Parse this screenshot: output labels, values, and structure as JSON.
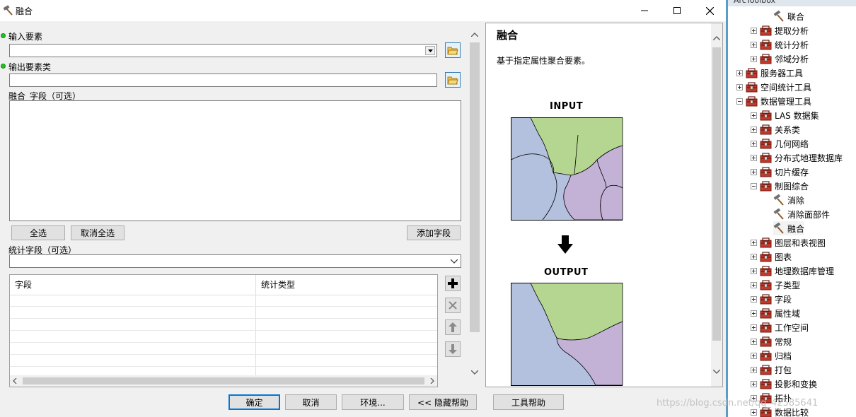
{
  "window": {
    "title": "融合",
    "minimize_icon": "minimize-icon",
    "maximize_icon": "maximize-icon",
    "close_icon": "close-icon"
  },
  "form": {
    "input_features_label": "输入要素",
    "output_class_label": "输出要素类",
    "dissolve_fields_label": "融合_字段（可选）",
    "select_all_label": "全选",
    "unselect_all_label": "取消全选",
    "add_field_label": "添加字段",
    "statistics_fields_label": "统计字段（可选）",
    "table_headers": [
      "字段",
      "统计类型"
    ],
    "table_rows": 6
  },
  "help": {
    "title": "融合",
    "description": "基于指定属性聚合要素。",
    "input_caption": "INPUT",
    "output_caption": "OUTPUT",
    "colors": {
      "blue": "#b3c0de",
      "green": "#b5d690",
      "purple": "#c3b2d6"
    }
  },
  "footer": {
    "ok_label": "确定",
    "cancel_label": "取消",
    "env_label": "环境...",
    "hide_help_label": "<< 隐藏帮助",
    "tool_help_label": "工具帮助"
  },
  "toolbox": {
    "header": "ArcToolbox",
    "items": [
      {
        "label": "联合",
        "type": "tool",
        "indent": 2
      },
      {
        "label": "提取分析",
        "type": "box",
        "indent": 1
      },
      {
        "label": "统计分析",
        "type": "box",
        "indent": 1
      },
      {
        "label": "邻域分析",
        "type": "box",
        "indent": 1
      },
      {
        "label": "服务器工具",
        "type": "box",
        "indent": 0
      },
      {
        "label": "空间统计工具",
        "type": "box",
        "indent": 0
      },
      {
        "label": "数据管理工具",
        "type": "box",
        "indent": 0,
        "expanded": true
      },
      {
        "label": "LAS 数据集",
        "type": "box",
        "indent": 1
      },
      {
        "label": "关系类",
        "type": "box",
        "indent": 1
      },
      {
        "label": "几何网络",
        "type": "box",
        "indent": 1
      },
      {
        "label": "分布式地理数据库",
        "type": "box",
        "indent": 1
      },
      {
        "label": "切片缓存",
        "type": "box",
        "indent": 1
      },
      {
        "label": "制图综合",
        "type": "box",
        "indent": 1,
        "expanded": true
      },
      {
        "label": "消除",
        "type": "tool",
        "indent": 2
      },
      {
        "label": "消除面部件",
        "type": "tool",
        "indent": 2
      },
      {
        "label": "融合",
        "type": "tool",
        "indent": 2,
        "selected": true
      },
      {
        "label": "图层和表视图",
        "type": "box",
        "indent": 1
      },
      {
        "label": "图表",
        "type": "box",
        "indent": 1
      },
      {
        "label": "地理数据库管理",
        "type": "box",
        "indent": 1
      },
      {
        "label": "子类型",
        "type": "box",
        "indent": 1
      },
      {
        "label": "字段",
        "type": "box",
        "indent": 1
      },
      {
        "label": "属性域",
        "type": "box",
        "indent": 1
      },
      {
        "label": "工作空间",
        "type": "box",
        "indent": 1
      },
      {
        "label": "常规",
        "type": "box",
        "indent": 1
      },
      {
        "label": "归档",
        "type": "box",
        "indent": 1
      },
      {
        "label": "打包",
        "type": "box",
        "indent": 1
      },
      {
        "label": "投影和变换",
        "type": "box",
        "indent": 1
      },
      {
        "label": "拓扑",
        "type": "box",
        "indent": 1
      },
      {
        "label": "数据比较",
        "type": "box",
        "indent": 1
      }
    ]
  },
  "watermark": "https://blog.csdn.net/qq_42585641"
}
